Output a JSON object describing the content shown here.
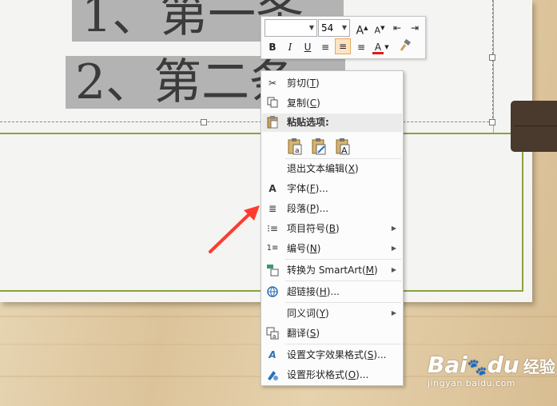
{
  "slide": {
    "line1": "1、第一条",
    "line2": "2、第二条"
  },
  "mini_toolbar": {
    "font_name": "",
    "font_size": "54",
    "grow_font": "A",
    "shrink_font": "A",
    "bold": "B",
    "italic": "I",
    "underline": "U",
    "font_color": "A",
    "font_color_value": "#e01b1b"
  },
  "context_menu": {
    "items": [
      {
        "label": "剪切",
        "accel": "T",
        "icon": "scissors-icon"
      },
      {
        "label": "复制",
        "accel": "C",
        "icon": "copy-icon"
      }
    ],
    "paste_header": "粘贴选项:",
    "exit_edit": {
      "label": "退出文本编辑",
      "accel": "X"
    },
    "font": {
      "label": "字体",
      "accel": "F",
      "suffix": "..."
    },
    "paragraph": {
      "label": "段落",
      "accel": "P",
      "suffix": "..."
    },
    "bullets": {
      "label": "项目符号",
      "accel": "B"
    },
    "numbering": {
      "label": "编号",
      "accel": "N"
    },
    "smartart": {
      "label": "转换为 SmartArt",
      "accel": "M"
    },
    "hyperlink": {
      "label": "超链接",
      "accel": "H",
      "suffix": "..."
    },
    "synonyms": {
      "label": "同义词",
      "accel": "Y"
    },
    "translate": {
      "label": "翻译",
      "accel": "S"
    },
    "text_effects": {
      "label": "设置文字效果格式",
      "accel": "S",
      "suffix": "..."
    },
    "shape_format": {
      "label": "设置形状格式",
      "accel": "O",
      "suffix": "..."
    }
  },
  "watermark": {
    "brand": "Bai",
    "brand2": "du",
    "cn": "经验",
    "url": "jingyan.baidu.com"
  },
  "colors": {
    "accent_green": "#8aa33c",
    "arrow_red": "#ff3b30",
    "highlight": "#fce4c2"
  }
}
